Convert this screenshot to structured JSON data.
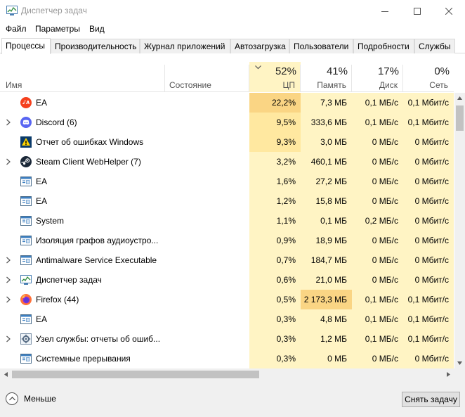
{
  "window": {
    "title": "Диспетчер задач"
  },
  "menu": [
    "Файл",
    "Параметры",
    "Вид"
  ],
  "tabs": [
    {
      "label": "Процессы",
      "active": true
    },
    {
      "label": "Производительность",
      "active": false
    },
    {
      "label": "Журнал приложений",
      "active": false
    },
    {
      "label": "Автозагрузка",
      "active": false
    },
    {
      "label": "Пользователи",
      "active": false
    },
    {
      "label": "Подробности",
      "active": false
    },
    {
      "label": "Службы",
      "active": false
    }
  ],
  "columns": {
    "name": "Имя",
    "status": "Состояние",
    "cpu": {
      "percent": "52%",
      "label": "ЦП"
    },
    "memory": {
      "percent": "41%",
      "label": "Память"
    },
    "disk": {
      "percent": "17%",
      "label": "Диск"
    },
    "network": {
      "percent": "0%",
      "label": "Сеть"
    }
  },
  "rows": [
    {
      "name": "EA",
      "expandable": false,
      "icon": "ea-icon",
      "cpu": "22,2%",
      "mem": "7,3 МБ",
      "disk": "0,1 МБ/с",
      "net": "0,1 Мбит/с",
      "cpu_level": 3,
      "mem_level": 1,
      "disk_level": 1,
      "net_level": 1
    },
    {
      "name": "Discord (6)",
      "expandable": true,
      "icon": "discord-icon",
      "cpu": "9,5%",
      "mem": "333,6 МБ",
      "disk": "0,1 МБ/с",
      "net": "0,1 Мбит/с",
      "cpu_level": 2,
      "mem_level": 1,
      "disk_level": 1,
      "net_level": 1
    },
    {
      "name": "Отчет об ошибках Windows",
      "expandable": false,
      "icon": "error-report-icon",
      "cpu": "9,3%",
      "mem": "3,0 МБ",
      "disk": "0 МБ/с",
      "net": "0 Мбит/с",
      "cpu_level": 2,
      "mem_level": 1,
      "disk_level": 1,
      "net_level": 1
    },
    {
      "name": "Steam Client WebHelper (7)",
      "expandable": true,
      "icon": "steam-icon",
      "cpu": "3,2%",
      "mem": "460,1 МБ",
      "disk": "0 МБ/с",
      "net": "0 Мбит/с",
      "cpu_level": 1,
      "mem_level": 1,
      "disk_level": 1,
      "net_level": 1
    },
    {
      "name": "EA",
      "expandable": false,
      "icon": "window-app-icon",
      "cpu": "1,6%",
      "mem": "27,2 МБ",
      "disk": "0 МБ/с",
      "net": "0 Мбит/с",
      "cpu_level": 1,
      "mem_level": 1,
      "disk_level": 1,
      "net_level": 1
    },
    {
      "name": "EA",
      "expandable": false,
      "icon": "window-app-icon",
      "cpu": "1,2%",
      "mem": "15,8 МБ",
      "disk": "0 МБ/с",
      "net": "0 Мбит/с",
      "cpu_level": 1,
      "mem_level": 1,
      "disk_level": 1,
      "net_level": 1
    },
    {
      "name": "System",
      "expandable": false,
      "icon": "window-app-icon",
      "cpu": "1,1%",
      "mem": "0,1 МБ",
      "disk": "0,2 МБ/с",
      "net": "0 Мбит/с",
      "cpu_level": 1,
      "mem_level": 1,
      "disk_level": 1,
      "net_level": 1
    },
    {
      "name": "Изоляция графов аудиоустро...",
      "expandable": false,
      "icon": "window-app-icon",
      "cpu": "0,9%",
      "mem": "18,9 МБ",
      "disk": "0 МБ/с",
      "net": "0 Мбит/с",
      "cpu_level": 1,
      "mem_level": 1,
      "disk_level": 1,
      "net_level": 1
    },
    {
      "name": "Antimalware Service Executable",
      "expandable": true,
      "icon": "window-app-icon",
      "cpu": "0,7%",
      "mem": "184,7 МБ",
      "disk": "0 МБ/с",
      "net": "0 Мбит/с",
      "cpu_level": 1,
      "mem_level": 1,
      "disk_level": 1,
      "net_level": 1
    },
    {
      "name": "Диспетчер задач",
      "expandable": true,
      "icon": "task-manager-icon",
      "cpu": "0,6%",
      "mem": "21,0 МБ",
      "disk": "0 МБ/с",
      "net": "0 Мбит/с",
      "cpu_level": 1,
      "mem_level": 1,
      "disk_level": 1,
      "net_level": 1
    },
    {
      "name": "Firefox (44)",
      "expandable": true,
      "icon": "firefox-icon",
      "cpu": "0,5%",
      "mem": "2 173,3 МБ",
      "disk": "0,1 МБ/с",
      "net": "0,1 Мбит/с",
      "cpu_level": 1,
      "mem_level": 3,
      "disk_level": 1,
      "net_level": 1
    },
    {
      "name": "EA",
      "expandable": false,
      "icon": "window-app-icon",
      "cpu": "0,3%",
      "mem": "4,8 МБ",
      "disk": "0,1 МБ/с",
      "net": "0,1 Мбит/с",
      "cpu_level": 1,
      "mem_level": 1,
      "disk_level": 1,
      "net_level": 1
    },
    {
      "name": "Узел службы: отчеты об ошиб...",
      "expandable": true,
      "icon": "service-host-icon",
      "cpu": "0,3%",
      "mem": "1,2 МБ",
      "disk": "0,1 МБ/с",
      "net": "0,1 Мбит/с",
      "cpu_level": 1,
      "mem_level": 1,
      "disk_level": 1,
      "net_level": 1
    },
    {
      "name": "Системные прерывания",
      "expandable": false,
      "icon": "window-app-icon",
      "cpu": "0,3%",
      "mem": "0 МБ",
      "disk": "0 МБ/с",
      "net": "0 Мбит/с",
      "cpu_level": 1,
      "mem_level": 1,
      "disk_level": 1,
      "net_level": 1
    }
  ],
  "footer": {
    "less_label": "Меньше",
    "end_task_label": "Снять задачу"
  },
  "colors": {
    "heat_1": "#fff4c4",
    "heat_2": "#ffe8a0",
    "heat_3": "#fad584",
    "cpu_header_bg": "#fff4c4"
  }
}
